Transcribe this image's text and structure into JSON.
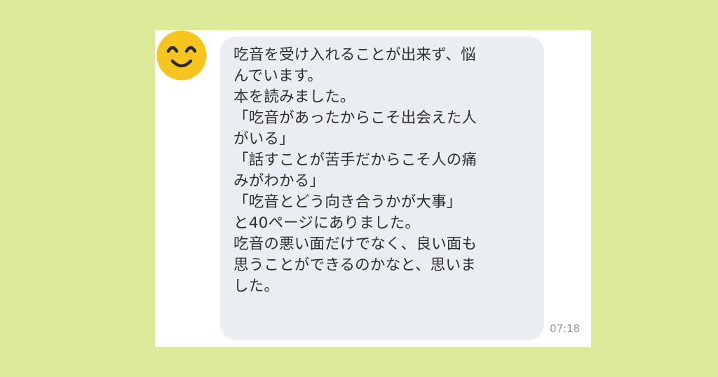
{
  "chat": {
    "avatar_icon": "smiling-face-icon",
    "message_lines": [
      "吃音を受け入れることが出来ず、悩",
      "んでいます。",
      "本を読みました。",
      "「吃音があったからこそ出会えた人",
      "がいる」",
      "「話すことが苦手だからこそ人の痛",
      "みがわかる」",
      "「吃音とどう向き合うかが大事」",
      "と40ページにありました。",
      "吃音の悪い面だけでなく、良い面も",
      "思うことができるのかなと、思いま",
      "した。"
    ],
    "timestamp": "07:18"
  },
  "colors": {
    "page_background": "#dcea9a",
    "card_background": "#ffffff",
    "bubble_background": "#eaedf1",
    "avatar": "#f7c51f",
    "text": "#2f2f2f",
    "timestamp": "#8f959c"
  }
}
